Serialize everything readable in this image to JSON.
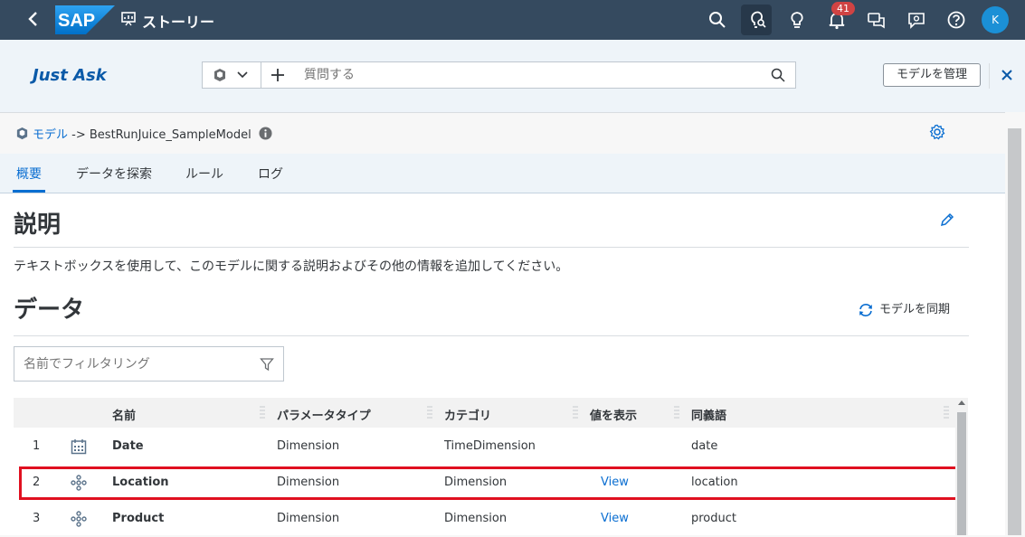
{
  "shell": {
    "story_title": "ストーリー",
    "notification_count": "41",
    "avatar_initial": "K"
  },
  "just_ask": {
    "title": "Just Ask",
    "question_placeholder": "質問する",
    "manage_model_label": "モデルを管理"
  },
  "breadcrumb": {
    "model_label": "モデル",
    "separator": " -> ",
    "model_name": "BestRunJuice_SampleModel"
  },
  "tabs": [
    {
      "label": "概要"
    },
    {
      "label": "データを探索"
    },
    {
      "label": "ルール"
    },
    {
      "label": "ログ"
    }
  ],
  "description": {
    "heading": "説明",
    "text": "テキストボックスを使用して、このモデルに関する説明およびその他の情報を追加してください。"
  },
  "data_section": {
    "heading": "データ",
    "sync_label": "モデルを同期",
    "filter_placeholder": "名前でフィルタリング"
  },
  "table": {
    "columns": [
      "名前",
      "パラメータタイプ",
      "カテゴリ",
      "値を表示",
      "同義語"
    ],
    "rows": [
      {
        "num": "1",
        "icon": "calendar-icon",
        "name": "Date",
        "type": "Dimension",
        "category": "TimeDimension",
        "view": "",
        "synonym": "date"
      },
      {
        "num": "2",
        "icon": "hierarchy-icon",
        "name": "Location",
        "type": "Dimension",
        "category": "Dimension",
        "view": "View",
        "synonym": "location"
      },
      {
        "num": "3",
        "icon": "hierarchy-icon",
        "name": "Product",
        "type": "Dimension",
        "category": "Dimension",
        "view": "View",
        "synonym": "product"
      }
    ]
  },
  "colors": {
    "shell": "#354a5f",
    "accent": "#0a6ed1",
    "highlight": "#e01020",
    "badge": "#d04343"
  }
}
